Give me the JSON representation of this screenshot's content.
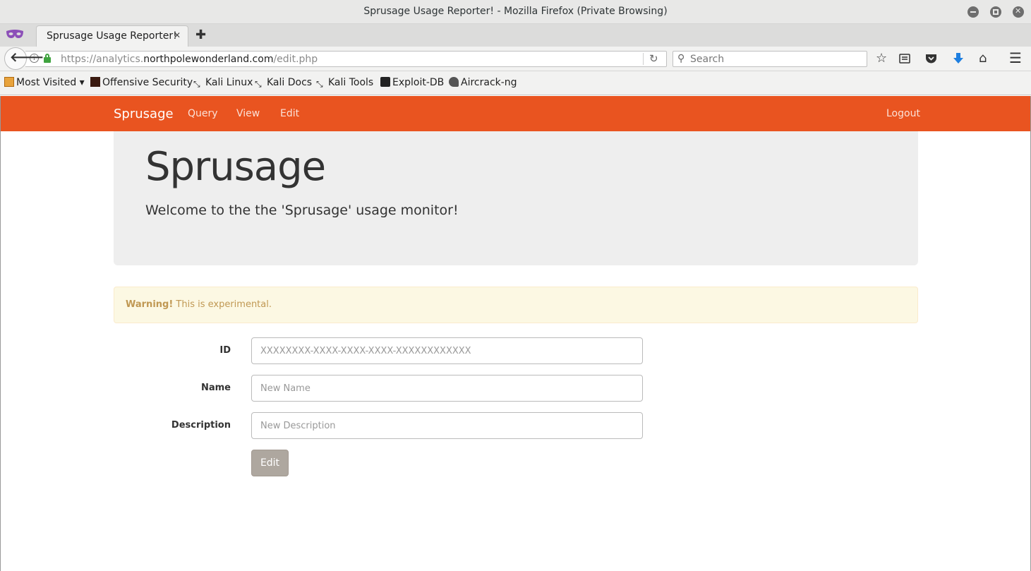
{
  "window": {
    "title": "Sprusage Usage Reporter! - Mozilla Firefox (Private Browsing)"
  },
  "browser": {
    "tab_title": "Sprusage Usage Reporter!",
    "url_prefix": "https://analytics.",
    "url_host": "northpolewonderland.com",
    "url_path": "/edit.php",
    "search_placeholder": "Search",
    "bookmarks": [
      {
        "label": "Most Visited ▾",
        "icon": "most-visited-icon"
      },
      {
        "label": "Offensive Security",
        "icon": "offsec-icon"
      },
      {
        "label": "Kali Linux",
        "icon": "kali-icon"
      },
      {
        "label": "Kali Docs",
        "icon": "kali-icon"
      },
      {
        "label": "Kali Tools",
        "icon": "kali-icon"
      },
      {
        "label": "Exploit-DB",
        "icon": "exploitdb-icon"
      },
      {
        "label": "Aircrack-ng",
        "icon": "aircrack-icon"
      }
    ]
  },
  "site": {
    "brand": "Sprusage",
    "nav": [
      "Query",
      "View",
      "Edit"
    ],
    "logout": "Logout",
    "accent_color": "#e95420"
  },
  "jumbotron": {
    "heading": "Sprusage",
    "lead": "Welcome to the the 'Sprusage' usage monitor!"
  },
  "alert": {
    "strong": "Warning!",
    "text": " This is experimental."
  },
  "form": {
    "id_label": "ID",
    "id_placeholder": "XXXXXXXX-XXXX-XXXX-XXXX-XXXXXXXXXXXX",
    "name_label": "Name",
    "name_placeholder": "New Name",
    "description_label": "Description",
    "description_placeholder": "New Description",
    "submit_label": "Edit"
  }
}
